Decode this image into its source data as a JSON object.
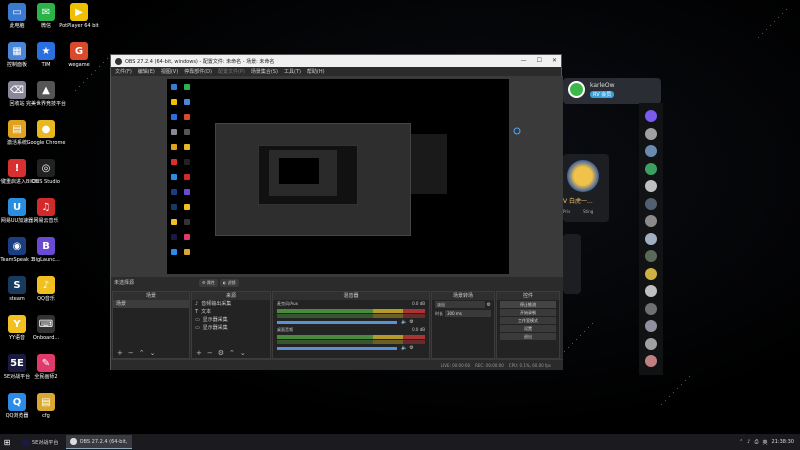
{
  "desktop": {
    "icons_left": [
      {
        "label": "此电脑",
        "color": "#3a7ad0",
        "glyph": "▭"
      },
      {
        "label": "控制面板",
        "color": "#4a86d8",
        "glyph": "▦"
      },
      {
        "label": "回收站",
        "color": "#889",
        "glyph": "⌫"
      },
      {
        "label": "激活系统",
        "color": "#e0a020",
        "glyph": "▤"
      },
      {
        "label": "一键重启进入BIOS",
        "color": "#d83030",
        "glyph": "!"
      },
      {
        "label": "网易UU加速器",
        "color": "#2a8ee0",
        "glyph": "U"
      },
      {
        "label": "TeamSpeak 3",
        "color": "#1a3e80",
        "glyph": "◉"
      },
      {
        "label": "steam",
        "color": "#173a5e",
        "glyph": "S"
      },
      {
        "label": "YY语音",
        "color": "#f2c020",
        "glyph": "Y"
      },
      {
        "label": "5E对战平台",
        "color": "#1a1a40",
        "glyph": "5E"
      },
      {
        "label": "QQ浏览器",
        "color": "#2a8ce8",
        "glyph": "Q"
      }
    ],
    "icons_mid": [
      {
        "label": "微信",
        "color": "#2bb34a",
        "glyph": "✉"
      },
      {
        "label": "TIM",
        "color": "#2a6fe0",
        "glyph": "★"
      },
      {
        "label": "完美世界竞技平台",
        "color": "#555",
        "glyph": "▲"
      },
      {
        "label": "Google Chrome",
        "color": "#e8b820",
        "glyph": "●"
      },
      {
        "label": "OBS Studio",
        "color": "#222",
        "glyph": "◎"
      },
      {
        "label": "网易云音乐",
        "color": "#d02a2a",
        "glyph": "♫"
      },
      {
        "label": "BigLaunc...",
        "color": "#6a4ad0",
        "glyph": "B"
      },
      {
        "label": "QQ音乐",
        "color": "#f0c020",
        "glyph": "♪"
      },
      {
        "label": "Onboard...",
        "color": "#333",
        "glyph": "⌨"
      },
      {
        "label": "全民画师2",
        "color": "#e03a6a",
        "glyph": "✎"
      },
      {
        "label": "cfg",
        "color": "#d8a830",
        "glyph": "▤"
      }
    ],
    "icons_right": [
      {
        "label": "PotPlayer 64 bit",
        "color": "#f0c000",
        "glyph": "▶"
      },
      {
        "label": "wegame",
        "color": "#d84a2a",
        "glyph": "G"
      }
    ]
  },
  "chat": {
    "username": "karleOw",
    "level_badge": "RV",
    "level_tag": "会员",
    "card_name": "V 白虎一...",
    "card_sub": "Priv",
    "card_sub2": "Sting"
  },
  "obs": {
    "title": "OBS 27.2.4 (64-bit, windows) - 配置文件: 未命名 - 场景: 未命名",
    "menu": [
      "文件(F)",
      "编辑(E)",
      "视图(V)",
      "停靠部件(D)",
      "配置文件(P)",
      "场景集合(S)",
      "工具(T)",
      "帮助(H)"
    ],
    "window_controls": [
      "—",
      "☐",
      "✕"
    ],
    "no_source_label": "未选择源",
    "mini_btns": [
      "属性",
      "滤镜"
    ],
    "scenes": {
      "header": "场景",
      "items": [
        "场景"
      ]
    },
    "sources": {
      "header": "来源",
      "items": [
        "音频输出采集",
        "文本",
        "显示器采集",
        "显示器采集"
      ]
    },
    "mixer": {
      "header": "混音器",
      "channels": [
        {
          "name": "麦克风/Aux",
          "db": "0.0 dB"
        },
        {
          "name": "桌面音频",
          "db": "0.0 dB"
        }
      ]
    },
    "transitions": {
      "header": "场景转场",
      "type": "淡出",
      "duration_label": "时长",
      "duration": "300 ms"
    },
    "controls": {
      "header": "控件",
      "buttons": [
        "停止推流",
        "开始录制",
        "工作室模式",
        "设置",
        "退出"
      ]
    },
    "status": [
      "LIVE: 00:00:00",
      "REC: 00:00:00",
      "CPU: 0.1%, 60.00 fps"
    ]
  },
  "taskbar": {
    "start_glyph": "⊞",
    "tasks": [
      {
        "label": "5E对战平台",
        "active": false
      },
      {
        "label": "OBS 27.2.4 (64-bit, ...",
        "active": true
      }
    ],
    "tray": [
      "⌃",
      "♪",
      "⎙",
      "英",
      "21:38:30"
    ]
  }
}
